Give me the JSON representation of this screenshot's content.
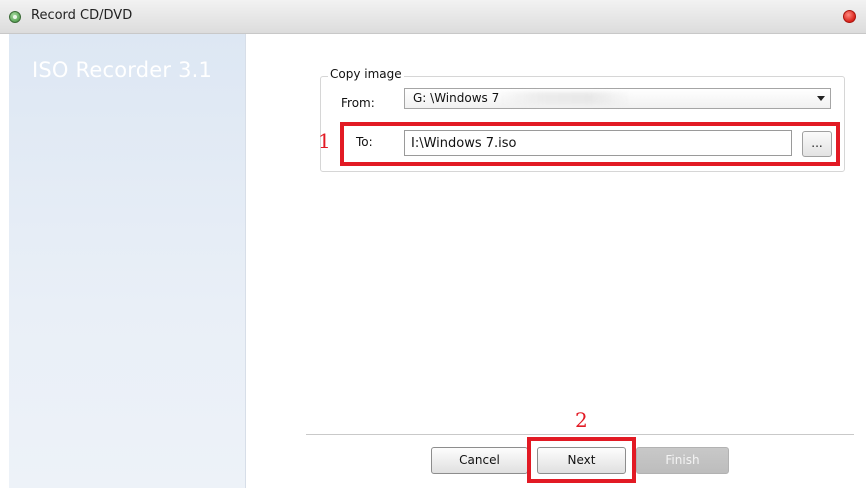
{
  "window": {
    "title": "Record CD/DVD",
    "icon": "app-disc-icon",
    "close_icon": "close-icon"
  },
  "sidebar": {
    "title": "ISO Recorder 3.1"
  },
  "copy_image": {
    "legend": "Copy image",
    "from_label": "From:",
    "from_value": "G: \\Windows 7",
    "to_label": "To:",
    "to_value": "I:\\Windows 7.iso",
    "browse_label": "..."
  },
  "annotations": {
    "marker_1": "1",
    "marker_2": "2",
    "color": "#e21a24"
  },
  "buttons": {
    "cancel": "Cancel",
    "next": "Next",
    "finish": "Finish"
  }
}
